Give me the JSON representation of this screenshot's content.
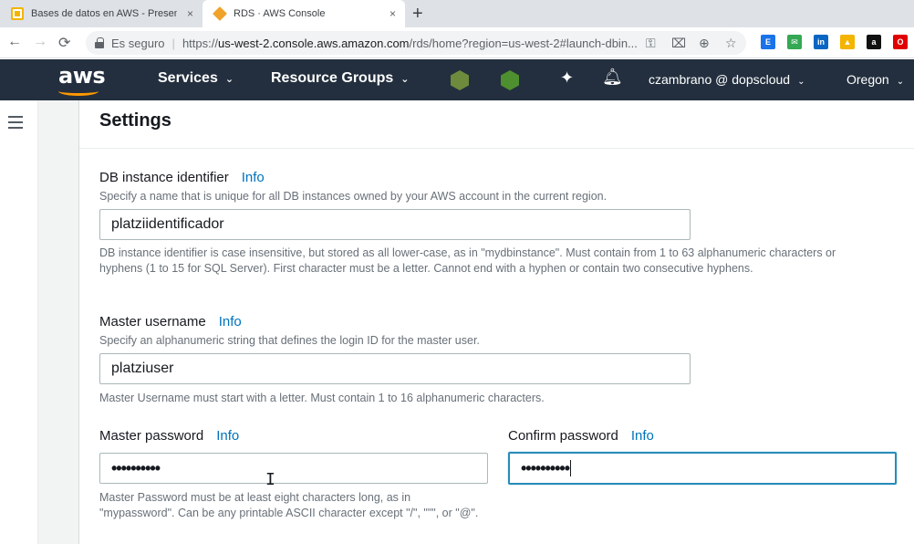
{
  "browser": {
    "tabs": [
      {
        "title": "Bases de datos en AWS - Present",
        "close": "×"
      },
      {
        "title": "RDS · AWS Console",
        "close": "×"
      }
    ],
    "new_tab": "+",
    "nav": {
      "back": "←",
      "forward": "→",
      "reload": "⟳"
    },
    "address": {
      "secure_label": "Es seguro",
      "url_prefix": "https://",
      "url_host": "us-west-2.console.aws.amazon.com",
      "url_rest": "/rds/home?region=us-west-2#launch-dbin..."
    },
    "omni_icons": {
      "key": "⚿",
      "translate": "⌧",
      "zoom": "⊕",
      "star": "☆"
    },
    "extensions": [
      {
        "name": "e-ext",
        "text": "E",
        "color": "#1a73e8"
      },
      {
        "name": "mail-ext",
        "text": "✉",
        "color": "#34a853"
      },
      {
        "name": "linkedin-ext",
        "text": "in",
        "color": "#0a66c2"
      },
      {
        "name": "drive-ext",
        "text": "▲",
        "color": "#f4b400"
      },
      {
        "name": "amazon-ext",
        "text": "a",
        "color": "#111111"
      },
      {
        "name": "opera-ext",
        "text": "O",
        "color": "#e00000"
      }
    ]
  },
  "aws": {
    "logo": "aws",
    "services": "Services",
    "resource_groups": "Resource Groups",
    "caret": "⌄",
    "user": "czambrano @ dopscloud",
    "region": "Oregon",
    "pin": "✦",
    "bell": "🔔︎"
  },
  "settings": {
    "title": "Settings",
    "info": "Info",
    "db_identifier": {
      "label": "DB instance identifier",
      "description": "Specify a name that is unique for all DB instances owned by your AWS account in the current region.",
      "value": "platziidentificador",
      "hint": "DB instance identifier is case insensitive, but stored as all lower-case, as in \"mydbinstance\". Must contain from 1 to 63 alphanumeric characters or hyphens (1 to 15 for SQL Server). First character must be a letter. Cannot end with a hyphen or contain two consecutive hyphens."
    },
    "master_username": {
      "label": "Master username",
      "description": "Specify an alphanumeric string that defines the login ID for the master user.",
      "value": "platziuser",
      "hint": "Master Username must start with a letter. Must contain 1 to 16 alphanumeric characters."
    },
    "master_password": {
      "label": "Master password",
      "value": "••••••••••",
      "hint": "Master Password must be at least eight characters long, as in \"mypassword\". Can be any printable ASCII character except \"/\", \"\"\", or \"@\"."
    },
    "confirm_password": {
      "label": "Confirm password",
      "value": "••••••••••"
    }
  }
}
